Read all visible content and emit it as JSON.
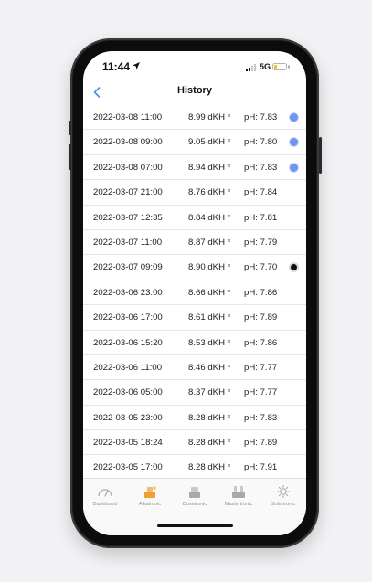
{
  "status_bar": {
    "time": "11:44",
    "network": "5G"
  },
  "nav": {
    "back_icon": "chevron-left-icon",
    "title": "History"
  },
  "colors": {
    "accent": "#4a90e2",
    "marker_blue": "#6f95f2",
    "marker_black": "#111111",
    "tab_active": "#f0a030",
    "tab_inactive": "#8e8e93"
  },
  "rows": [
    {
      "date": "2022-03-08 11:00",
      "dkh": "8.99 dKH *",
      "ph": "pH: 7.83",
      "marker": "blue"
    },
    {
      "date": "2022-03-08 09:00",
      "dkh": "9.05 dKH *",
      "ph": "pH: 7.80",
      "marker": "blue"
    },
    {
      "date": "2022-03-08 07:00",
      "dkh": "8.94 dKH *",
      "ph": "pH: 7.83",
      "marker": "blue"
    },
    {
      "date": "2022-03-07 21:00",
      "dkh": "8.76 dKH *",
      "ph": "pH: 7.84",
      "marker": ""
    },
    {
      "date": "2022-03-07 12:35",
      "dkh": "8.84 dKH *",
      "ph": "pH: 7.81",
      "marker": ""
    },
    {
      "date": "2022-03-07 11:00",
      "dkh": "8.87 dKH *",
      "ph": "pH: 7.79",
      "marker": ""
    },
    {
      "date": "2022-03-07 09:09",
      "dkh": "8.90 dKH *",
      "ph": "pH: 7.70",
      "marker": "black"
    },
    {
      "date": "2022-03-06 23:00",
      "dkh": "8.66 dKH *",
      "ph": "pH: 7.86",
      "marker": ""
    },
    {
      "date": "2022-03-06 17:00",
      "dkh": "8.61 dKH *",
      "ph": "pH: 7.89",
      "marker": ""
    },
    {
      "date": "2022-03-06 15:20",
      "dkh": "8.53 dKH *",
      "ph": "pH: 7.86",
      "marker": ""
    },
    {
      "date": "2022-03-06 11:00",
      "dkh": "8.46 dKH *",
      "ph": "pH: 7.77",
      "marker": ""
    },
    {
      "date": "2022-03-06 05:00",
      "dkh": "8.37 dKH *",
      "ph": "pH: 7.77",
      "marker": ""
    },
    {
      "date": "2022-03-05 23:00",
      "dkh": "8.28 dKH *",
      "ph": "pH: 7.83",
      "marker": ""
    },
    {
      "date": "2022-03-05 18:24",
      "dkh": "8.28 dKH *",
      "ph": "pH: 7.89",
      "marker": ""
    },
    {
      "date": "2022-03-05 17:00",
      "dkh": "8.28 dKH *",
      "ph": "pH: 7.91",
      "marker": ""
    }
  ],
  "tabs": [
    {
      "label": "Dashboard",
      "icon": "gauge-icon"
    },
    {
      "label": "Alkatronic",
      "icon": "alkatronic-device-icon",
      "active": true
    },
    {
      "label": "Dosetronic",
      "icon": "dosetronic-device-icon"
    },
    {
      "label": "Mastertronic",
      "icon": "mastertronic-device-icon"
    },
    {
      "label": "Solartronic",
      "icon": "sun-icon"
    }
  ]
}
